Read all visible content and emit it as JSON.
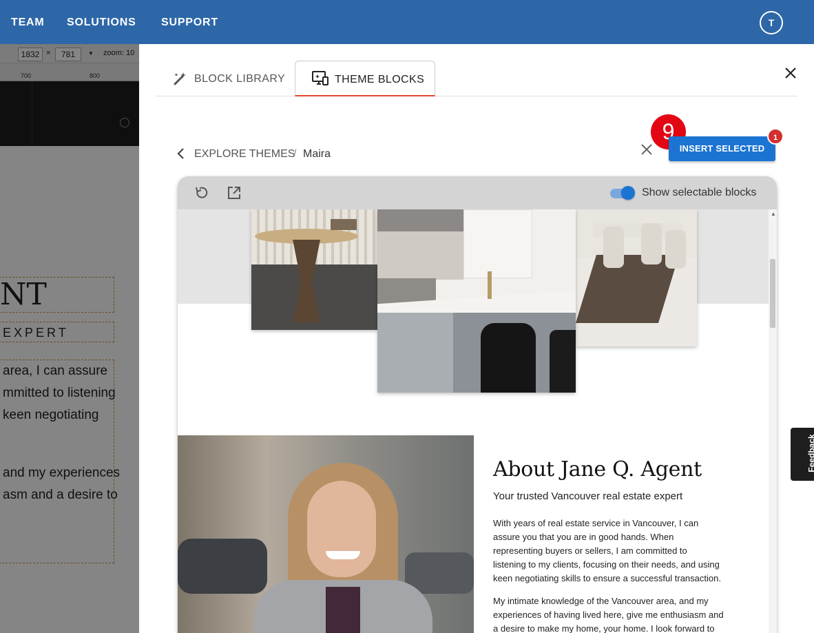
{
  "topnav": {
    "links": [
      "TEAM",
      "SOLUTIONS",
      "SUPPORT"
    ],
    "avatar_initial": "T"
  },
  "editor": {
    "width_value": "1832",
    "height_value": "781",
    "times_sign": "×",
    "zoom_label": "zoom: 10",
    "ruler_ticks": [
      "700",
      "800"
    ],
    "heading_fragment": "NT",
    "subheading_fragment": "EXPERT",
    "body_lines": [
      "area, I can assure",
      "mmitted to listening",
      "keen negotiating",
      "and my experiences",
      "asm and a desire to"
    ]
  },
  "panel": {
    "tabs": [
      {
        "label": "BLOCK LIBRARY",
        "icon": "magic-wand-icon"
      },
      {
        "label": "THEME BLOCKS",
        "icon": "theme-monitor-icon"
      }
    ],
    "active_tab": "THEME BLOCKS",
    "breadcrumb": {
      "parent": "EXPLORE THEMES",
      "separator": "/",
      "current": "Maira"
    },
    "step_number": "9",
    "insert_label": "INSERT SELECTED",
    "selected_count": "1",
    "toggle_label": "Show selectable blocks",
    "toggle_on": true
  },
  "about": {
    "title": "About Jane Q. Agent",
    "subtitle": "Your trusted Vancouver real estate expert",
    "paragraph1_lines": [
      "With years of real estate service in Vancouver, I can",
      "assure you that you are in good hands. When",
      "representing buyers or sellers, I am committed to",
      "listening to my clients, focusing on their needs, and using",
      "keen negotiating skills to ensure a successful transaction."
    ],
    "paragraph2_lines": [
      "My intimate knowledge of the Vancouver area, and my",
      "experiences of having lived here, give me enthusiasm and",
      "a desire to make my home, your home. I look forward to"
    ]
  },
  "feedback_label": "Feedback",
  "colors": {
    "nav": "#2d67a8",
    "accent": "#1b74d2",
    "tab_underline": "#e0462e",
    "step_badge": "#e30613"
  }
}
